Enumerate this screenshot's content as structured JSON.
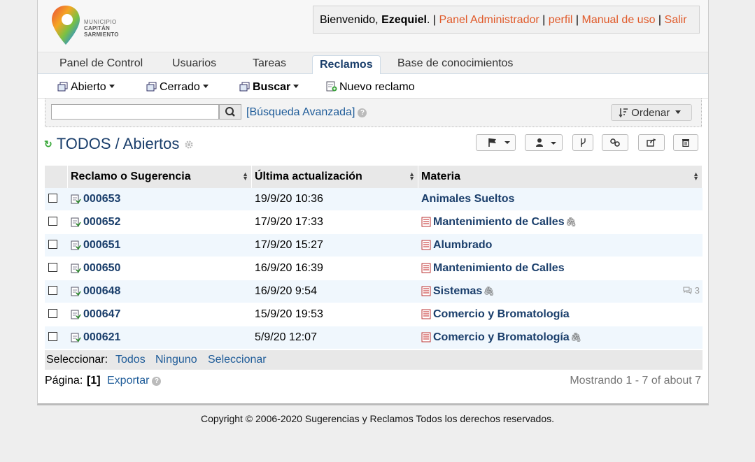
{
  "logo": {
    "line1": "MUNICIPIO",
    "line2": "CAPITÁN SARMIENTO"
  },
  "user": {
    "greeting": "Bienvenido,",
    "name": "Ezequiel",
    "dot": ".",
    "sep": "|",
    "admin_panel": "Panel Administrador",
    "profile": "perfil",
    "manual": "Manual de uso",
    "logout": "Salir"
  },
  "tabs": [
    "Panel de Control",
    "Usuarios",
    "Tareas",
    "Reclamos",
    "Base de conocimientos"
  ],
  "active_tab": "Reclamos",
  "subnav": {
    "open": "Abierto",
    "closed": "Cerrado",
    "search": "Buscar",
    "new": "Nuevo reclamo"
  },
  "search": {
    "placeholder": "",
    "advanced": "[Búsqueda Avanzada]",
    "sort": "Ordenar"
  },
  "queue": {
    "title": "TODOS / Abiertos"
  },
  "table": {
    "headers": [
      "Reclamo o Sugerencia",
      "Última actualización",
      "Materia"
    ],
    "rows": [
      {
        "number": "000653",
        "updated": "19/9/20 10:36",
        "subject": "Animales Sueltos",
        "attach": false,
        "comments": ""
      },
      {
        "number": "000652",
        "updated": "17/9/20 17:33",
        "subject": "Mantenimiento de Calles",
        "attach": true,
        "comments": ""
      },
      {
        "number": "000651",
        "updated": "17/9/20 15:27",
        "subject": "Alumbrado",
        "attach": false,
        "comments": ""
      },
      {
        "number": "000650",
        "updated": "16/9/20 16:39",
        "subject": "Mantenimiento de Calles",
        "attach": false,
        "comments": ""
      },
      {
        "number": "000648",
        "updated": "16/9/20 9:54",
        "subject": "Sistemas",
        "attach": true,
        "comments": "3"
      },
      {
        "number": "000647",
        "updated": "15/9/20 19:53",
        "subject": "Comercio y Bromatología",
        "attach": false,
        "comments": ""
      },
      {
        "number": "000621",
        "updated": "5/9/20 12:07",
        "subject": "Comercio y Bromatología",
        "attach": true,
        "comments": ""
      }
    ]
  },
  "select": {
    "label": "Seleccionar:",
    "all": "Todos",
    "none": "Ninguno",
    "choose": "Seleccionar"
  },
  "pager": {
    "label": "Página:",
    "current": "[1]",
    "export": "Exportar",
    "showing": "Mostrando 1 - 7 of about 7"
  },
  "footer": {
    "text": "Copyright © 2006-2020 Sugerencias y Reclamos Todos los derechos reservados."
  }
}
